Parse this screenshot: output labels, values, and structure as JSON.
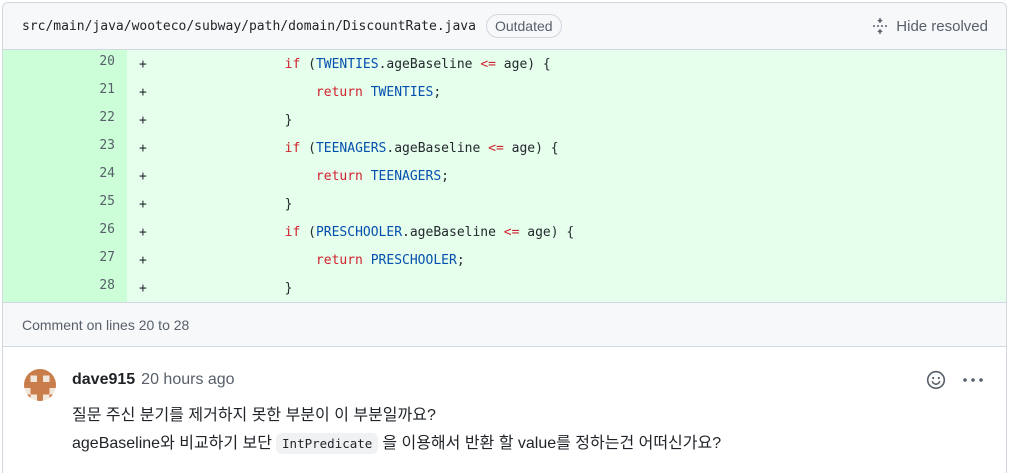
{
  "file": {
    "path": "src/main/java/wooteco/subway/path/domain/DiscountRate.java",
    "badge": "Outdated",
    "hide_resolved_label": "Hide resolved",
    "hide_resolved_icon": "fold-icon"
  },
  "diff": {
    "lines": [
      {
        "num": "20",
        "sign": "+",
        "indent": "        ",
        "tokens": [
          {
            "t": "kw",
            "v": "if"
          },
          {
            "t": "",
            "v": " ("
          },
          {
            "t": "cn",
            "v": "TWENTIES"
          },
          {
            "t": "",
            "v": ".ageBaseline "
          },
          {
            "t": "op",
            "v": "<="
          },
          {
            "t": "",
            "v": " age) {"
          }
        ]
      },
      {
        "num": "21",
        "sign": "+",
        "indent": "            ",
        "tokens": [
          {
            "t": "kw",
            "v": "return"
          },
          {
            "t": "",
            "v": " "
          },
          {
            "t": "cn",
            "v": "TWENTIES"
          },
          {
            "t": "",
            "v": ";"
          }
        ]
      },
      {
        "num": "22",
        "sign": "+",
        "indent": "        ",
        "tokens": [
          {
            "t": "",
            "v": "}"
          }
        ]
      },
      {
        "num": "23",
        "sign": "+",
        "indent": "        ",
        "tokens": [
          {
            "t": "kw",
            "v": "if"
          },
          {
            "t": "",
            "v": " ("
          },
          {
            "t": "cn",
            "v": "TEENAGERS"
          },
          {
            "t": "",
            "v": ".ageBaseline "
          },
          {
            "t": "op",
            "v": "<="
          },
          {
            "t": "",
            "v": " age) {"
          }
        ]
      },
      {
        "num": "24",
        "sign": "+",
        "indent": "            ",
        "tokens": [
          {
            "t": "kw",
            "v": "return"
          },
          {
            "t": "",
            "v": " "
          },
          {
            "t": "cn",
            "v": "TEENAGERS"
          },
          {
            "t": "",
            "v": ";"
          }
        ]
      },
      {
        "num": "25",
        "sign": "+",
        "indent": "        ",
        "tokens": [
          {
            "t": "",
            "v": "}"
          }
        ]
      },
      {
        "num": "26",
        "sign": "+",
        "indent": "        ",
        "tokens": [
          {
            "t": "kw",
            "v": "if"
          },
          {
            "t": "",
            "v": " ("
          },
          {
            "t": "cn",
            "v": "PRESCHOOLER"
          },
          {
            "t": "",
            "v": ".ageBaseline "
          },
          {
            "t": "op",
            "v": "<="
          },
          {
            "t": "",
            "v": " age) {"
          }
        ]
      },
      {
        "num": "27",
        "sign": "+",
        "indent": "            ",
        "tokens": [
          {
            "t": "kw",
            "v": "return"
          },
          {
            "t": "",
            "v": " "
          },
          {
            "t": "cn",
            "v": "PRESCHOOLER"
          },
          {
            "t": "",
            "v": ";"
          }
        ]
      },
      {
        "num": "28",
        "sign": "+",
        "indent": "        ",
        "tokens": [
          {
            "t": "",
            "v": "}"
          }
        ]
      }
    ]
  },
  "comment_on": "Comment on lines 20 to 28",
  "comment": {
    "author": "dave915",
    "time": "20 hours ago",
    "line1": "질문 주신 분기를 제거하지 못한 부분이 이 부분일까요?",
    "line2_before": "ageBaseline와 비교하기 보단",
    "line2_code": "IntPredicate",
    "line2_after": "을 이용해서 반환 할 value를 정하는건 어떠신가요?",
    "emoji_icon": "smiley-icon",
    "more_icon": "kebab-horizontal-icon"
  },
  "colors": {
    "added_bg": "#e6ffec",
    "added_num_bg": "#ccffd8",
    "keyword": "#cf222e",
    "constant": "#0550ae"
  }
}
